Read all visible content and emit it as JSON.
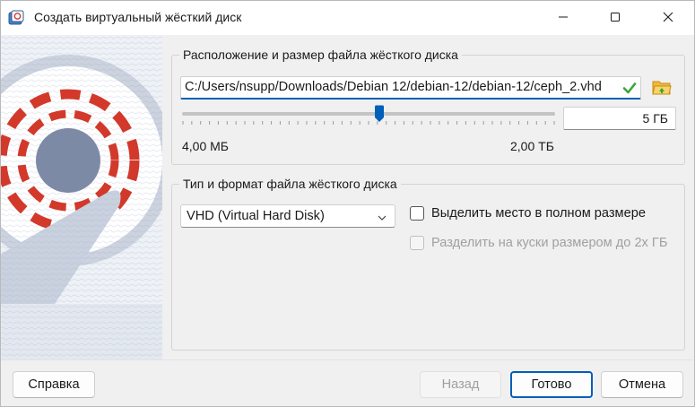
{
  "window": {
    "title": "Создать виртуальный жёсткий диск"
  },
  "location_group": {
    "title": "Расположение и размер файла жёсткого диска",
    "path_value": "C:/Users/nsupp/Downloads/Debian 12/debian-12/debian-12/ceph_2.vhd",
    "size_value": "5 ГБ",
    "slider_position": 0.53,
    "range_min": "4,00 МБ",
    "range_max": "2,00 ТБ"
  },
  "format_group": {
    "title": "Тип и формат файла жёсткого диска",
    "format_selected": "VHD (Virtual Hard Disk)",
    "preallocate_label": "Выделить место в полном размере",
    "preallocate_checked": false,
    "split_label": "Разделить на куски размером до 2х ГБ",
    "split_checked": false,
    "split_enabled": false
  },
  "footer": {
    "help_label": "Справка",
    "back_label": "Назад",
    "done_label": "Готово",
    "cancel_label": "Отмена"
  },
  "icons": {
    "app": "virtualbox-disk-icon",
    "minimize": "minimize-icon",
    "maximize": "maximize-icon",
    "close": "close-icon",
    "valid": "checkmark-icon",
    "folder": "folder-open-icon",
    "dropdown": "chevron-down-icon"
  },
  "colors": {
    "accent": "#005fb8",
    "valid_green": "#3aa63a",
    "art_red": "#d2392b",
    "art_slate": "#7a8aa6"
  }
}
